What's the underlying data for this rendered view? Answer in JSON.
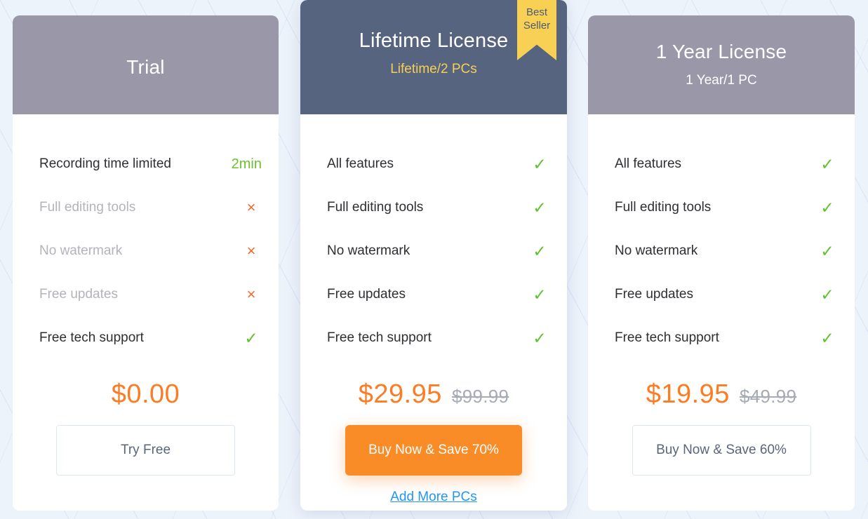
{
  "page": {
    "background_color": "#edf3fb",
    "accent_orange": "#fa8c28",
    "accent_green": "#5fc12e",
    "accent_red": "#f2692f",
    "accent_yellow": "#f8d154",
    "link_blue": "#2196f3"
  },
  "plans": [
    {
      "id": "trial",
      "title": "Trial",
      "subtitle": "",
      "header_color": "#9a98a8",
      "badge": null,
      "features": [
        {
          "label": "Recording time limited",
          "mark": "2min",
          "mark_type": "text",
          "enabled": true
        },
        {
          "label": "Full editing tools",
          "mark": "×",
          "mark_type": "cross",
          "enabled": false
        },
        {
          "label": "No watermark",
          "mark": "×",
          "mark_type": "cross",
          "enabled": false
        },
        {
          "label": "Free updates",
          "mark": "×",
          "mark_type": "cross",
          "enabled": false
        },
        {
          "label": "Free tech support",
          "mark": "✓",
          "mark_type": "check",
          "enabled": true
        }
      ],
      "price_current": "$0.00",
      "price_old": "",
      "cta_label": "Try Free",
      "cta_style": "outline",
      "link_label": ""
    },
    {
      "id": "lifetime",
      "title": "Lifetime License",
      "subtitle": "Lifetime/2 PCs",
      "header_color": "#576480",
      "badge": {
        "line1": "Best",
        "line2": "Seller"
      },
      "features": [
        {
          "label": "All features",
          "mark": "✓",
          "mark_type": "check",
          "enabled": true
        },
        {
          "label": "Full editing tools",
          "mark": "✓",
          "mark_type": "check",
          "enabled": true
        },
        {
          "label": "No watermark",
          "mark": "✓",
          "mark_type": "check",
          "enabled": true
        },
        {
          "label": "Free updates",
          "mark": "✓",
          "mark_type": "check",
          "enabled": true
        },
        {
          "label": "Free tech support",
          "mark": "✓",
          "mark_type": "check",
          "enabled": true
        }
      ],
      "price_current": "$29.95",
      "price_old": "$99.99",
      "cta_label": "Buy Now & Save 70%",
      "cta_style": "filled",
      "link_label": "Add More PCs"
    },
    {
      "id": "yearly",
      "title": "1 Year License",
      "subtitle": "1 Year/1 PC",
      "header_color": "#9a98a8",
      "badge": null,
      "features": [
        {
          "label": "All features",
          "mark": "✓",
          "mark_type": "check",
          "enabled": true
        },
        {
          "label": "Full editing tools",
          "mark": "✓",
          "mark_type": "check",
          "enabled": true
        },
        {
          "label": "No watermark",
          "mark": "✓",
          "mark_type": "check",
          "enabled": true
        },
        {
          "label": "Free updates",
          "mark": "✓",
          "mark_type": "check",
          "enabled": true
        },
        {
          "label": "Free tech support",
          "mark": "✓",
          "mark_type": "check",
          "enabled": true
        }
      ],
      "price_current": "$19.95",
      "price_old": "$49.99",
      "cta_label": "Buy Now & Save 60%",
      "cta_style": "outline",
      "link_label": ""
    }
  ]
}
